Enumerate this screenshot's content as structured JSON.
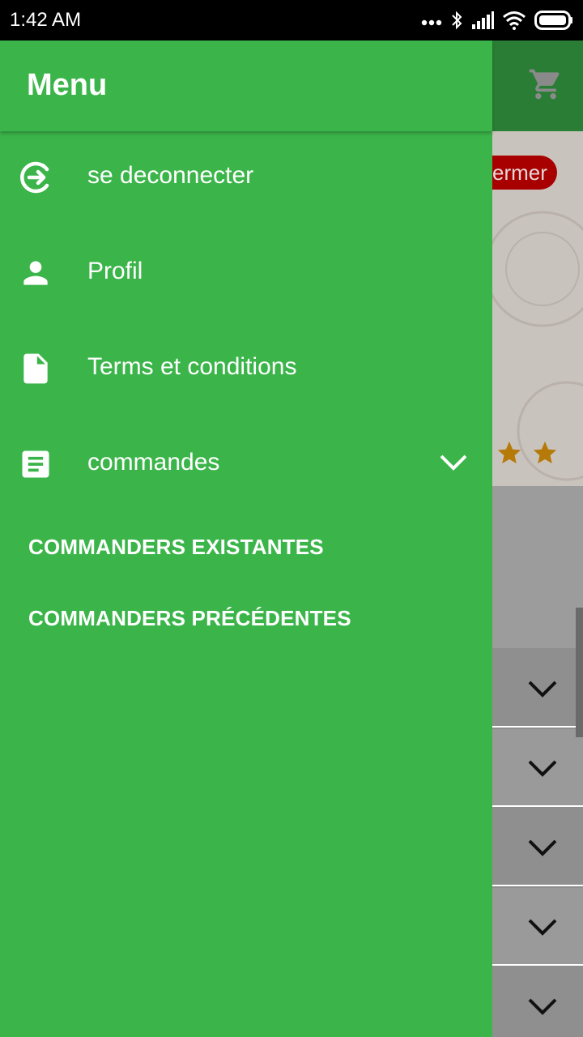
{
  "status_bar": {
    "time": "1:42 AM",
    "icons": [
      "more-dots-icon",
      "bluetooth-icon",
      "signal-icon",
      "wifi-icon",
      "battery-icon"
    ]
  },
  "background": {
    "appbar_color": "#2a7d35",
    "cart_icon": "cart-icon",
    "badge_text": "ermer",
    "stars": [
      "star-icon",
      "star-icon"
    ],
    "collapsed_rows": 5
  },
  "drawer": {
    "title": "Menu",
    "accent": "#3bb54a",
    "items": [
      {
        "label": "se deconnecter",
        "icon": "logout-icon"
      },
      {
        "label": "Profil",
        "icon": "person-icon"
      },
      {
        "label": "Terms et conditions",
        "icon": "document-icon"
      },
      {
        "label": "commandes",
        "icon": "list-article-icon",
        "expandable": true
      }
    ],
    "sub_items": [
      {
        "label": "COMMANDERS EXISTANTES"
      },
      {
        "label": "COMMANDERS PRÉCÉDENTES"
      }
    ]
  }
}
